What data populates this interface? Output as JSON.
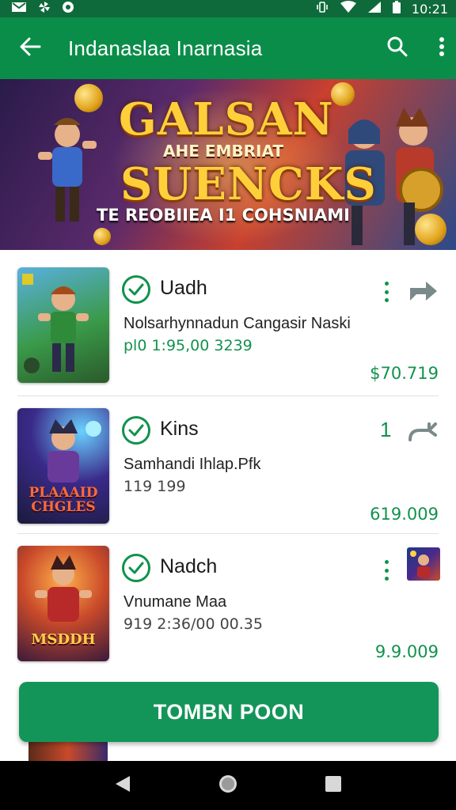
{
  "status_bar": {
    "time": "10:21",
    "left_icons": [
      "mail-icon",
      "pinwheel-icon",
      "circle-badge-icon"
    ],
    "right_icons": [
      "vibrate-icon",
      "wifi-icon",
      "signal-icon",
      "battery-icon"
    ]
  },
  "app_bar": {
    "title": "Indanaslaa Inarnasia",
    "back_icon": "arrow-left-icon",
    "search_icon": "search-icon",
    "more_icon": "more-vert-icon"
  },
  "banner": {
    "title_line1": "GALSAN",
    "title_middle": "AHE EMBRIAT",
    "title_line2": "SUENCKS",
    "subtitle": "TE REOBIIEA I1 COHSNIAMI"
  },
  "items": [
    {
      "name": "Uadh",
      "line1": "Nolsarhynnadun Cangasir Naski",
      "line2": "pl0 1:95,00 3239",
      "line2_color": "green",
      "price": "$70.719",
      "right_control": "menu+share"
    },
    {
      "name": "Kins",
      "line1": "Samhandi Ihlap.Pfk",
      "line2": "119 199",
      "line2_color": "grey",
      "price": "619.009",
      "right_control": "number+reply",
      "number": "1",
      "thumb_text": "PLAAAID CHGLES"
    },
    {
      "name": "Nadch",
      "line1": "Vnumane Maa",
      "line2": "919 2:36/00 00.35",
      "line2_color": "grey",
      "price": "9.9.009",
      "right_control": "menu+thumb",
      "thumb_text": "MSDDH"
    }
  ],
  "cta": {
    "label": "TOMBN POON"
  },
  "nav_bar": {
    "back_icon": "triangle-back-icon",
    "home_icon": "circle-home-icon",
    "recents_icon": "square-recents-icon"
  },
  "colors": {
    "status_bar": "#0e6a3a",
    "app_bar": "#0b8d4a",
    "accent_green": "#11924d",
    "cta": "#13955a"
  }
}
